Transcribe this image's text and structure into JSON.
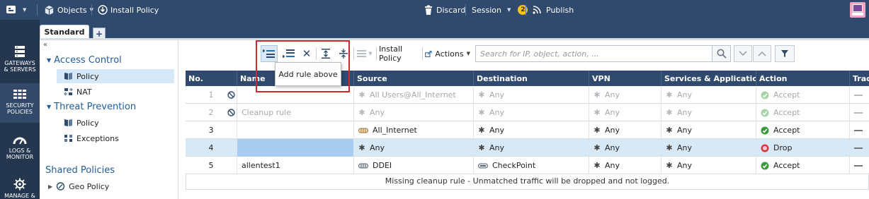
{
  "topbar": {
    "objects_label": "Objects",
    "install_policy_label": "Install Policy",
    "discard_label": "Discard",
    "session_label": "Session",
    "session_badge": "2",
    "publish_label": "Publish"
  },
  "tabs": {
    "active": "Standard",
    "add_label": "+"
  },
  "leftnav": [
    {
      "line1": "GATEWAYS",
      "line2": "& SERVERS"
    },
    {
      "line1": "SECURITY",
      "line2": "POLICIES"
    },
    {
      "line1": "LOGS &",
      "line2": "MONITOR"
    },
    {
      "line1": "MANAGE &",
      "line2": ""
    }
  ],
  "tree": {
    "collapse_label": "«",
    "access_control": "Access Control",
    "policy": "Policy",
    "nat": "NAT",
    "threat_prevention": "Threat Prevention",
    "tp_policy": "Policy",
    "exceptions": "Exceptions",
    "shared_policies": "Shared Policies",
    "geo_policy": "Geo Policy"
  },
  "toolbar": {
    "install_policy": "Install Policy",
    "actions": "Actions",
    "search_placeholder": "Search for IP, object, action, ...",
    "tooltip": "Add rule above"
  },
  "table": {
    "headers": [
      "No.",
      "Name",
      "Source",
      "Destination",
      "VPN",
      "Services & Applications",
      "Action",
      "Trac"
    ],
    "rows": [
      {
        "no": "1",
        "name": "",
        "source": "All Users@All_Internet",
        "destination": "Any",
        "vpn": "Any",
        "services": "Any",
        "action": "Accept",
        "disabled": true
      },
      {
        "no": "2",
        "name": "Cleanup rule",
        "source": "Any",
        "destination": "Any",
        "vpn": "Any",
        "services": "Any",
        "action": "Accept",
        "disabled": true
      },
      {
        "no": "3",
        "name": "",
        "source": "All_Internet",
        "destination": "Any",
        "vpn": "Any",
        "services": "Any",
        "action": "Accept",
        "disabled": false
      },
      {
        "no": "4",
        "name": "",
        "source": "Any",
        "destination": "Any",
        "vpn": "Any",
        "services": "Any",
        "action": "Drop",
        "disabled": false
      },
      {
        "no": "5",
        "name": "allentest1",
        "source": "DDEI",
        "destination": "CheckPoint",
        "vpn": "Any",
        "services": "Any",
        "action": "Accept",
        "disabled": false
      }
    ],
    "footer": "Missing cleanup rule - Unmatched traffic will be dropped and not logged."
  },
  "colors": {
    "topbar": "#2f4a6c",
    "leftnav": "#24374f",
    "accept": "#3b9a3b",
    "drop": "#d9363e",
    "highlight": "#d9232e"
  }
}
